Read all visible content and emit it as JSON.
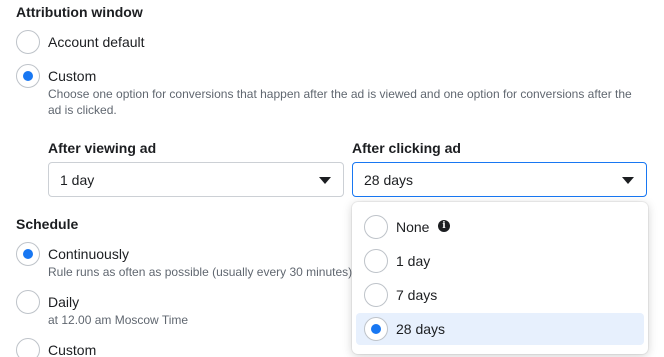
{
  "attribution": {
    "heading": "Attribution window",
    "options": [
      {
        "label": "Account default",
        "checked": false
      },
      {
        "label": "Custom",
        "checked": true,
        "description": "Choose one option for conversions that happen after the ad is viewed and one option for conversions after the ad is clicked."
      }
    ],
    "after_viewing": {
      "label": "After viewing ad",
      "value": "1 day"
    },
    "after_clicking": {
      "label": "After clicking ad",
      "value": "28 days"
    }
  },
  "schedule": {
    "heading": "Schedule",
    "options": [
      {
        "label": "Continuously",
        "checked": true,
        "description": "Rule runs as often as possible (usually every 30 minutes)."
      },
      {
        "label": "Daily",
        "checked": false,
        "description": "at 12.00 am Moscow Time"
      },
      {
        "label": "Custom",
        "checked": false
      }
    ]
  },
  "dropdown": {
    "options": [
      {
        "label": "None",
        "has_info_icon": true,
        "selected": false
      },
      {
        "label": "1 day",
        "selected": false
      },
      {
        "label": "7 days",
        "selected": false
      },
      {
        "label": "28 days",
        "selected": true
      }
    ]
  },
  "colors": {
    "accent": "#1877f2",
    "selected_bg": "#e7f0fd"
  },
  "icons": {
    "info": "info-icon",
    "caret": "caret-down-icon"
  }
}
